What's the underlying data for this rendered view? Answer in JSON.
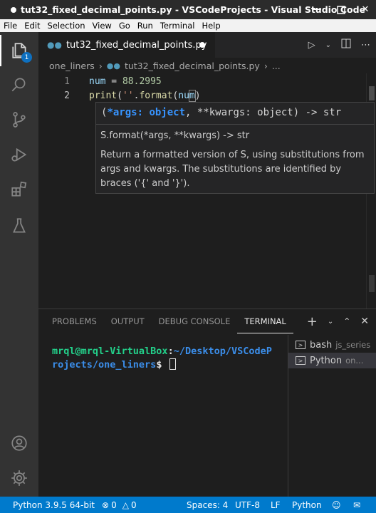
{
  "window": {
    "title": "tut32_fixed_decimal_points.py - VSCodeProjects - Visual Studio Code"
  },
  "menu": [
    "File",
    "Edit",
    "Selection",
    "View",
    "Go",
    "Run",
    "Terminal",
    "Help"
  ],
  "activity": {
    "explorer_badge": "1"
  },
  "tab": {
    "label": "tut32_fixed_decimal_points.py"
  },
  "breadcrumb": {
    "folder": "one_liners",
    "file": "tut32_fixed_decimal_points.py",
    "more": "..."
  },
  "editor": {
    "lines": [
      {
        "num": "1",
        "tokens": {
          "a": "num",
          "b": " = ",
          "c": "88.2995"
        }
      },
      {
        "num": "2",
        "tokens": {
          "a": "print",
          "b": "(",
          "c": "''",
          "d": ".",
          "e": "format",
          "f": "(",
          "g": "nu",
          "h": "m",
          "i": ")"
        }
      }
    ]
  },
  "tooltip": {
    "sig_open": "(",
    "sig_param": "*args: object",
    "sig_rest": ", **kwargs: object) -> str",
    "subtitle": "S.format(*args, **kwargs) -> str",
    "description": "Return a formatted version of S, using substitutions from args and kwargs. The substitutions are identified by braces ('{' and '}')."
  },
  "panel": {
    "tabs": [
      "PROBLEMS",
      "OUTPUT",
      "DEBUG CONSOLE",
      "TERMINAL"
    ],
    "terminal": {
      "user": "mrql@mrql-VirtualBox",
      "colon": ":",
      "path": "~/Desktop/VSCodeProjects/one_liners",
      "prompt": "$ "
    },
    "terminals": [
      {
        "name": "bash",
        "sub": "js_series"
      },
      {
        "name": "Python",
        "sub": "on..."
      }
    ]
  },
  "statusbar": {
    "python": "Python 3.9.5 64-bit",
    "errors": "0",
    "warnings": "0",
    "spaces": "Spaces: 4",
    "encoding": "UTF-8",
    "eol": "LF",
    "language": "Python"
  }
}
